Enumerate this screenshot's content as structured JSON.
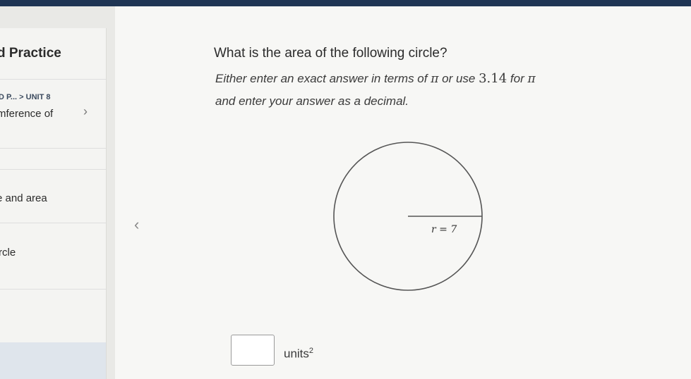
{
  "sidebar": {
    "title": "d Practice",
    "breadcrumb": "D P... > UNIT 8",
    "lesson": "mference of",
    "items": [
      {
        "label": "e and area"
      },
      {
        "label": "rcle"
      }
    ],
    "chevron_icon": "chevron-right-icon"
  },
  "main": {
    "back_icon": "chevron-left-icon",
    "question": "What is the area of the following circle?",
    "instructions": {
      "line1_a": "Either enter an exact answer in terms of ",
      "pi": "π",
      "line1_b": " or use ",
      "approx": "3.14",
      "line1_c": " for ",
      "line2": "and enter your answer as a decimal."
    },
    "diagram": {
      "radius_label": "r = 7",
      "radius_value": 7
    },
    "answer": {
      "value": "",
      "units": "units",
      "exponent": "2"
    }
  },
  "colors": {
    "topbar": "#1f3554",
    "background": "#f7f7f5",
    "sidebar": "#f4f4f2"
  }
}
